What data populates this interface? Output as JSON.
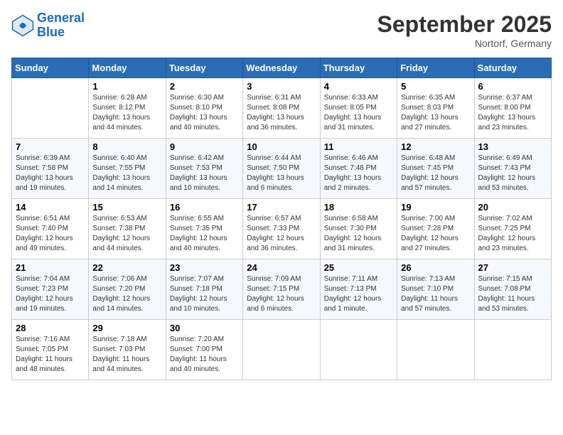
{
  "header": {
    "logo_line1": "General",
    "logo_line2": "Blue",
    "month_title": "September 2025",
    "location": "Nortorf, Germany"
  },
  "days_of_week": [
    "Sunday",
    "Monday",
    "Tuesday",
    "Wednesday",
    "Thursday",
    "Friday",
    "Saturday"
  ],
  "weeks": [
    [
      {
        "day": "",
        "info": ""
      },
      {
        "day": "1",
        "info": "Sunrise: 6:28 AM\nSunset: 8:12 PM\nDaylight: 13 hours\nand 44 minutes."
      },
      {
        "day": "2",
        "info": "Sunrise: 6:30 AM\nSunset: 8:10 PM\nDaylight: 13 hours\nand 40 minutes."
      },
      {
        "day": "3",
        "info": "Sunrise: 6:31 AM\nSunset: 8:08 PM\nDaylight: 13 hours\nand 36 minutes."
      },
      {
        "day": "4",
        "info": "Sunrise: 6:33 AM\nSunset: 8:05 PM\nDaylight: 13 hours\nand 31 minutes."
      },
      {
        "day": "5",
        "info": "Sunrise: 6:35 AM\nSunset: 8:03 PM\nDaylight: 13 hours\nand 27 minutes."
      },
      {
        "day": "6",
        "info": "Sunrise: 6:37 AM\nSunset: 8:00 PM\nDaylight: 13 hours\nand 23 minutes."
      }
    ],
    [
      {
        "day": "7",
        "info": "Sunrise: 6:39 AM\nSunset: 7:58 PM\nDaylight: 13 hours\nand 19 minutes."
      },
      {
        "day": "8",
        "info": "Sunrise: 6:40 AM\nSunset: 7:55 PM\nDaylight: 13 hours\nand 14 minutes."
      },
      {
        "day": "9",
        "info": "Sunrise: 6:42 AM\nSunset: 7:53 PM\nDaylight: 13 hours\nand 10 minutes."
      },
      {
        "day": "10",
        "info": "Sunrise: 6:44 AM\nSunset: 7:50 PM\nDaylight: 13 hours\nand 6 minutes."
      },
      {
        "day": "11",
        "info": "Sunrise: 6:46 AM\nSunset: 7:48 PM\nDaylight: 13 hours\nand 2 minutes."
      },
      {
        "day": "12",
        "info": "Sunrise: 6:48 AM\nSunset: 7:45 PM\nDaylight: 12 hours\nand 57 minutes."
      },
      {
        "day": "13",
        "info": "Sunrise: 6:49 AM\nSunset: 7:43 PM\nDaylight: 12 hours\nand 53 minutes."
      }
    ],
    [
      {
        "day": "14",
        "info": "Sunrise: 6:51 AM\nSunset: 7:40 PM\nDaylight: 12 hours\nand 49 minutes."
      },
      {
        "day": "15",
        "info": "Sunrise: 6:53 AM\nSunset: 7:38 PM\nDaylight: 12 hours\nand 44 minutes."
      },
      {
        "day": "16",
        "info": "Sunrise: 6:55 AM\nSunset: 7:35 PM\nDaylight: 12 hours\nand 40 minutes."
      },
      {
        "day": "17",
        "info": "Sunrise: 6:57 AM\nSunset: 7:33 PM\nDaylight: 12 hours\nand 36 minutes."
      },
      {
        "day": "18",
        "info": "Sunrise: 6:58 AM\nSunset: 7:30 PM\nDaylight: 12 hours\nand 31 minutes."
      },
      {
        "day": "19",
        "info": "Sunrise: 7:00 AM\nSunset: 7:28 PM\nDaylight: 12 hours\nand 27 minutes."
      },
      {
        "day": "20",
        "info": "Sunrise: 7:02 AM\nSunset: 7:25 PM\nDaylight: 12 hours\nand 23 minutes."
      }
    ],
    [
      {
        "day": "21",
        "info": "Sunrise: 7:04 AM\nSunset: 7:23 PM\nDaylight: 12 hours\nand 19 minutes."
      },
      {
        "day": "22",
        "info": "Sunrise: 7:06 AM\nSunset: 7:20 PM\nDaylight: 12 hours\nand 14 minutes."
      },
      {
        "day": "23",
        "info": "Sunrise: 7:07 AM\nSunset: 7:18 PM\nDaylight: 12 hours\nand 10 minutes."
      },
      {
        "day": "24",
        "info": "Sunrise: 7:09 AM\nSunset: 7:15 PM\nDaylight: 12 hours\nand 6 minutes."
      },
      {
        "day": "25",
        "info": "Sunrise: 7:11 AM\nSunset: 7:13 PM\nDaylight: 12 hours\nand 1 minute."
      },
      {
        "day": "26",
        "info": "Sunrise: 7:13 AM\nSunset: 7:10 PM\nDaylight: 11 hours\nand 57 minutes."
      },
      {
        "day": "27",
        "info": "Sunrise: 7:15 AM\nSunset: 7:08 PM\nDaylight: 11 hours\nand 53 minutes."
      }
    ],
    [
      {
        "day": "28",
        "info": "Sunrise: 7:16 AM\nSunset: 7:05 PM\nDaylight: 11 hours\nand 48 minutes."
      },
      {
        "day": "29",
        "info": "Sunrise: 7:18 AM\nSunset: 7:03 PM\nDaylight: 11 hours\nand 44 minutes."
      },
      {
        "day": "30",
        "info": "Sunrise: 7:20 AM\nSunset: 7:00 PM\nDaylight: 11 hours\nand 40 minutes."
      },
      {
        "day": "",
        "info": ""
      },
      {
        "day": "",
        "info": ""
      },
      {
        "day": "",
        "info": ""
      },
      {
        "day": "",
        "info": ""
      }
    ]
  ]
}
